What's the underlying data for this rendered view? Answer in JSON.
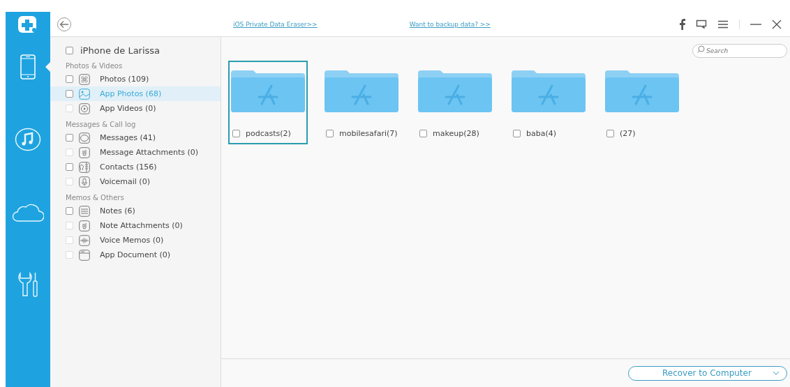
{
  "header": {
    "links": [
      "iOS Private Data Eraser>>",
      "Want to backup data? >>"
    ]
  },
  "rail": [
    {
      "kind": "device",
      "selected": true
    },
    {
      "kind": "music",
      "selected": false
    },
    {
      "kind": "cloud",
      "selected": false
    },
    {
      "kind": "tools",
      "selected": false
    }
  ],
  "sidebar": {
    "device": {
      "name": "iPhone de Larissa",
      "checked": false
    },
    "groups": [
      {
        "title": "Photos & Videos",
        "items": [
          {
            "kind": "photos",
            "label": "Photos (109)",
            "checked": false,
            "disabled": false,
            "selected": false
          },
          {
            "kind": "app-photos",
            "label": "App Photos (68)",
            "checked": false,
            "disabled": false,
            "selected": true
          },
          {
            "kind": "video",
            "label": "App Videos (0)",
            "checked": false,
            "disabled": true,
            "selected": false
          }
        ]
      },
      {
        "title": "Messages & Call log",
        "items": [
          {
            "kind": "message",
            "label": "Messages (41)",
            "checked": false,
            "disabled": false,
            "selected": false
          },
          {
            "kind": "attachment",
            "label": "Message Attachments (0)",
            "checked": false,
            "disabled": true,
            "selected": false
          },
          {
            "kind": "contacts",
            "label": "Contacts (156)",
            "checked": false,
            "disabled": false,
            "selected": false
          },
          {
            "kind": "voicemail",
            "label": "Voicemail (0)",
            "checked": false,
            "disabled": true,
            "selected": false
          }
        ]
      },
      {
        "title": "Memos & Others",
        "items": [
          {
            "kind": "notes",
            "label": "Notes (6)",
            "checked": false,
            "disabled": false,
            "selected": false
          },
          {
            "kind": "attachment",
            "label": "Note Attachments (0)",
            "checked": false,
            "disabled": true,
            "selected": false
          },
          {
            "kind": "voice-memo",
            "label": "Voice Memos (0)",
            "checked": false,
            "disabled": true,
            "selected": false
          },
          {
            "kind": "document",
            "label": "App Document (0)",
            "checked": false,
            "disabled": true,
            "selected": false
          }
        ]
      }
    ]
  },
  "search": {
    "placeholder": "Search"
  },
  "folders": [
    {
      "label": "podcasts(2)",
      "checked": false,
      "selected": true
    },
    {
      "label": "mobilesafari(7)",
      "checked": false,
      "selected": false
    },
    {
      "label": "makeup(28)",
      "checked": false,
      "selected": false
    },
    {
      "label": "baba(4)",
      "checked": false,
      "selected": false
    },
    {
      "label": "(27)",
      "checked": false,
      "selected": false
    }
  ],
  "recover_button": {
    "label": "Recover to Computer"
  }
}
